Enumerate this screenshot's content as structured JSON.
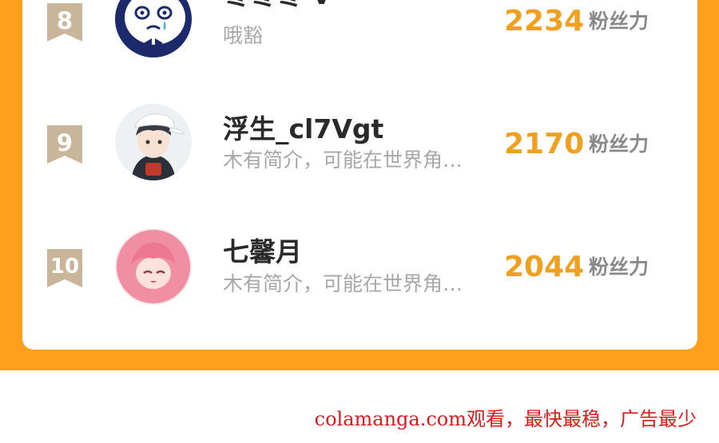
{
  "colors": {
    "panel_background": "#ff9f1c",
    "card_background": "#ffffff",
    "rank_badge": "#c8b59a",
    "fan_count": "#f0a020",
    "name_text": "#2a2a2a",
    "bio_text": "#a7a7a7",
    "watermark": "#d81b1b"
  },
  "leaderboard": {
    "rows": [
      {
        "rank": "8",
        "name": "枣枣枣-v-",
        "bio": "哦豁",
        "fans": "2234",
        "fans_unit": "粉丝力",
        "avatar_icon": "crying-cartoon-face-avatar"
      },
      {
        "rank": "9",
        "name": "浮生_cl7Vgt",
        "bio": "木有简介，可能在世界角…",
        "fans": "2170",
        "fans_unit": "粉丝力",
        "avatar_icon": "anime-boy-white-cap-avatar"
      },
      {
        "rank": "10",
        "name": "七馨月",
        "bio": "木有简介，可能在世界角…",
        "fans": "2044",
        "fans_unit": "粉丝力",
        "avatar_icon": "pink-hair-anime-girl-avatar"
      }
    ]
  },
  "watermark": {
    "text": "colamanga.com观看，最快最稳，广告最少"
  }
}
